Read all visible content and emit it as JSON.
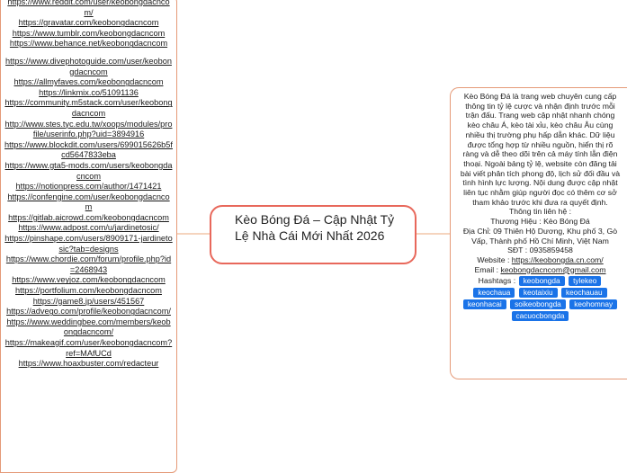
{
  "links": [
    "https://www.reddit.com/user/keobongdacncom/",
    "https://gravatar.com/keobongdacncom",
    "https://www.tumblr.com/keobongdacncom",
    "https://www.behance.net/keobongdacncom",
    "",
    "https://www.divephotoguide.com/user/keobongdacncom",
    "https://allmyfaves.com/keobongdacncom",
    "https://linkmix.co/51091136",
    "https://community.m5stack.com/user/keobongdacncom",
    "http://www.stes.tyc.edu.tw/xoops/modules/profile/userinfo.php?uid=3894916",
    "https://www.blockdit.com/users/699015626b5fcd5647833eba",
    "https://www.gta5-mods.com/users/keobongdacncom",
    "https://notionpress.com/author/1471421",
    "https://confengine.com/user/keobongdacncom",
    "https://gitlab.aicrowd.com/keobongdacncom",
    "https://www.adpost.com/u/jardinetosic/",
    "https://pinshape.com/users/8909171-jardinetosic?tab=designs",
    "https://www.chordie.com/forum/profile.php?id=2468943",
    "https://www.veyjoz.com/keobongdacncom",
    "https://portfolium.com/keobongdacncom",
    "https://game8.jp/users/451567",
    "https://advego.com/profile/keobongdacncom/",
    "https://www.weddingbee.com/members/keobongdacncom/",
    "https://makeagif.com/user/keobongdacncom?ref=MAfUCd",
    "https://www.hoaxbuster.com/redacteur"
  ],
  "center": {
    "title": "Kèo Bóng Đá – Cập Nhật Tỷ Lệ Nhà Cái Mới Nhất 2026"
  },
  "info": {
    "description": "Kèo Bóng Đá là trang web chuyên cung cấp thông tin tỷ lệ cược và nhận định trước mỗi trận đấu. Trang web cập nhật nhanh chóng kèo châu Á, kèo tài xỉu, kèo châu Âu cùng nhiều thị trường phụ hấp dẫn khác. Dữ liệu được tổng hợp từ nhiều nguồn, hiển thị rõ ràng và dễ theo dõi trên cả máy tính lẫn điện thoại. Ngoài bảng tỷ lệ, website còn đăng tải bài viết phân tích phong độ, lịch sử đối đầu và tình hình lực lượng. Nội dung được cập nhật liên tục nhằm giúp người đọc có thêm cơ sở tham khảo trước khi đưa ra quyết định.",
    "contact_heading": "Thông tin liên hệ :",
    "brand": "Thương Hiệu : Kèo Bóng Đá",
    "address": "Địa Chỉ: 09 Thiên Hộ Dương, Khu phố 3, Gò Vấp, Thành phố Hồ Chí Minh, Việt Nam",
    "phone": "SĐT : 0935859458",
    "website_label": "Website : ",
    "website_url": "https://keobongda.cn.com/",
    "email_label": "Email : ",
    "email": "keobongdacncom@gmail.com",
    "hashtags_label": "Hashtags :",
    "hashtags": [
      "keobongda",
      "tylekeo",
      "keochaua",
      "keotaixiu",
      "keochauau",
      "keonhacai",
      "soikeobongda",
      "keohomnay",
      "cacuocbongda"
    ]
  },
  "colors": {
    "connector": "#f2c5a8",
    "center_border": "#e8685b",
    "box_border": "#e59a78",
    "hashtag_bg": "#1a73e8"
  }
}
